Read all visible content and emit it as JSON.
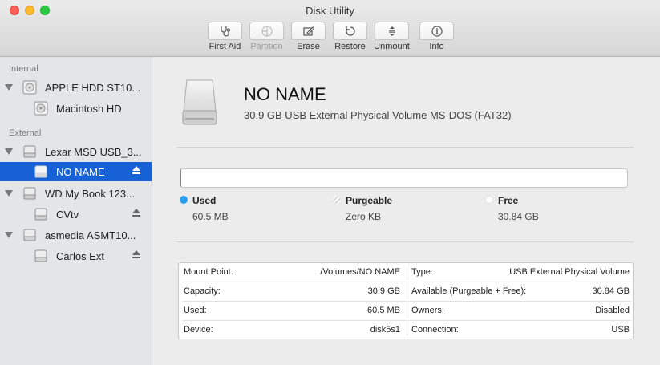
{
  "window": {
    "title": "Disk Utility"
  },
  "toolbar": {
    "buttons": [
      {
        "label": "First Aid",
        "icon": "stethoscope-icon",
        "enabled": true
      },
      {
        "label": "Partition",
        "icon": "pie-chart-icon",
        "enabled": false
      },
      {
        "label": "Erase",
        "icon": "pencil-erase-icon",
        "enabled": true
      },
      {
        "label": "Restore",
        "icon": "restore-arrow-icon",
        "enabled": true
      },
      {
        "label": "Unmount",
        "icon": "unmount-icon",
        "enabled": true
      },
      {
        "label": "Info",
        "icon": "info-icon",
        "enabled": true
      }
    ]
  },
  "sidebar": {
    "sections": [
      {
        "title": "Internal"
      },
      {
        "title": "External"
      }
    ],
    "items": [
      {
        "label": "APPLE HDD ST10...",
        "kind": "disk",
        "icon": "internal-disk-icon"
      },
      {
        "label": "Macintosh HD",
        "kind": "volume",
        "icon": "internal-volume-icon"
      },
      {
        "label": "Lexar MSD USB_3...",
        "kind": "disk",
        "icon": "external-disk-icon"
      },
      {
        "label": "NO NAME",
        "kind": "volume",
        "icon": "external-volume-icon",
        "selected": true,
        "eject": true
      },
      {
        "label": "WD My Book 123...",
        "kind": "disk",
        "icon": "external-disk-icon"
      },
      {
        "label": "CVtv",
        "kind": "volume",
        "icon": "external-volume-icon",
        "eject": true
      },
      {
        "label": "asmedia ASMT10...",
        "kind": "disk",
        "icon": "external-disk-icon"
      },
      {
        "label": "Carlos Ext",
        "kind": "volume",
        "icon": "external-volume-icon",
        "eject": true
      }
    ]
  },
  "volume": {
    "name": "NO NAME",
    "description": "30.9 GB USB External Physical Volume MS-DOS (FAT32)",
    "usage_fraction_used": 0.002
  },
  "legend": [
    {
      "label": "Used",
      "value": "60.5 MB",
      "color": "#2a9ff0"
    },
    {
      "label": "Purgeable",
      "value": "Zero KB",
      "color": "#d0d0d0"
    },
    {
      "label": "Free",
      "value": "30.84 GB",
      "color": "#ffffff"
    }
  ],
  "info": {
    "rows": [
      {
        "k1": "Mount Point:",
        "v1": "/Volumes/NO NAME",
        "k2": "Type:",
        "v2": "USB External Physical Volume"
      },
      {
        "k1": "Capacity:",
        "v1": "30.9 GB",
        "k2": "Available (Purgeable + Free):",
        "v2": "30.84 GB"
      },
      {
        "k1": "Used:",
        "v1": "60.5 MB",
        "k2": "Owners:",
        "v2": "Disabled"
      },
      {
        "k1": "Device:",
        "v1": "disk5s1",
        "k2": "Connection:",
        "v2": "USB"
      }
    ]
  }
}
